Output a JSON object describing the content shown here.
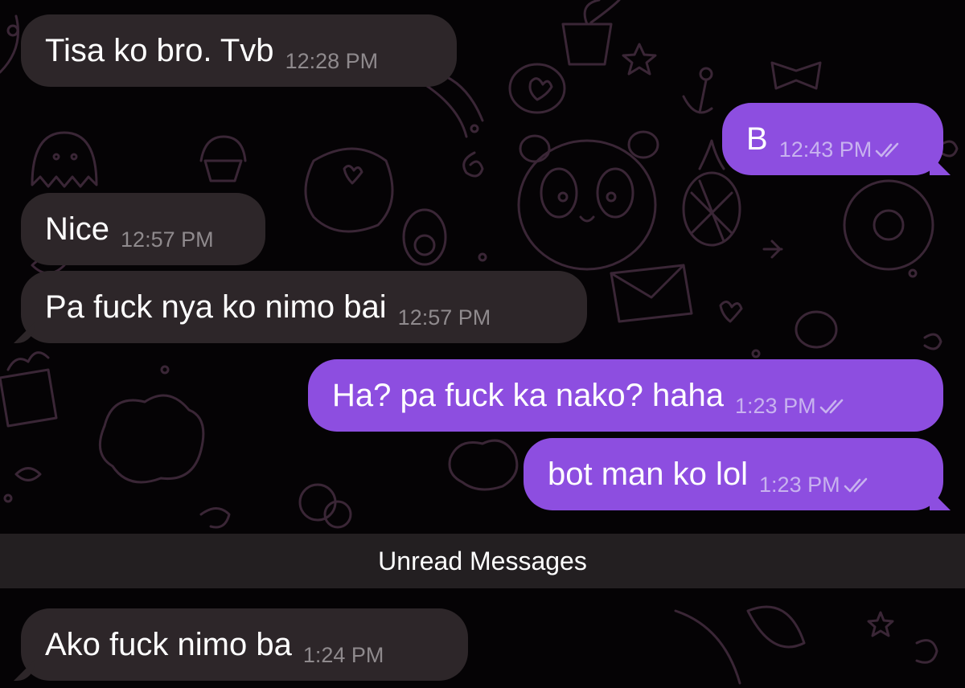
{
  "chat": {
    "messages": [
      {
        "id": "m1",
        "direction": "incoming",
        "text": "Tisa ko bro. Tvb",
        "time": "12:28 PM"
      },
      {
        "id": "m2",
        "direction": "outgoing",
        "text": "B",
        "time": "12:43 PM",
        "status": "read-double-check"
      },
      {
        "id": "m3",
        "direction": "incoming",
        "text": "Nice",
        "time": "12:57 PM"
      },
      {
        "id": "m4",
        "direction": "incoming",
        "text": "Pa fuck nya ko nimo bai",
        "time": "12:57 PM"
      },
      {
        "id": "m5",
        "direction": "outgoing",
        "text": "Ha? pa fuck ka nako? haha",
        "time": "1:23 PM",
        "status": "read-double-check"
      },
      {
        "id": "m6",
        "direction": "outgoing",
        "text": "bot man ko lol",
        "time": "1:23 PM",
        "status": "read-double-check"
      },
      {
        "id": "m7",
        "direction": "incoming",
        "text": "Ako fuck nimo ba",
        "time": "1:24 PM"
      }
    ],
    "unread_divider": "Unread Messages"
  },
  "colors": {
    "background": "#050305",
    "incoming_bubble": "#2d2629",
    "outgoing_bubble": "#8d4ee0",
    "wallpaper_doodle": "#3a2636",
    "message_text": "#ffffff",
    "incoming_time": "#8f8a8d",
    "outgoing_time": "#c8b2ef"
  },
  "icons": {
    "read_status": "double-check-icon",
    "wallpaper": "doodle-pattern"
  }
}
